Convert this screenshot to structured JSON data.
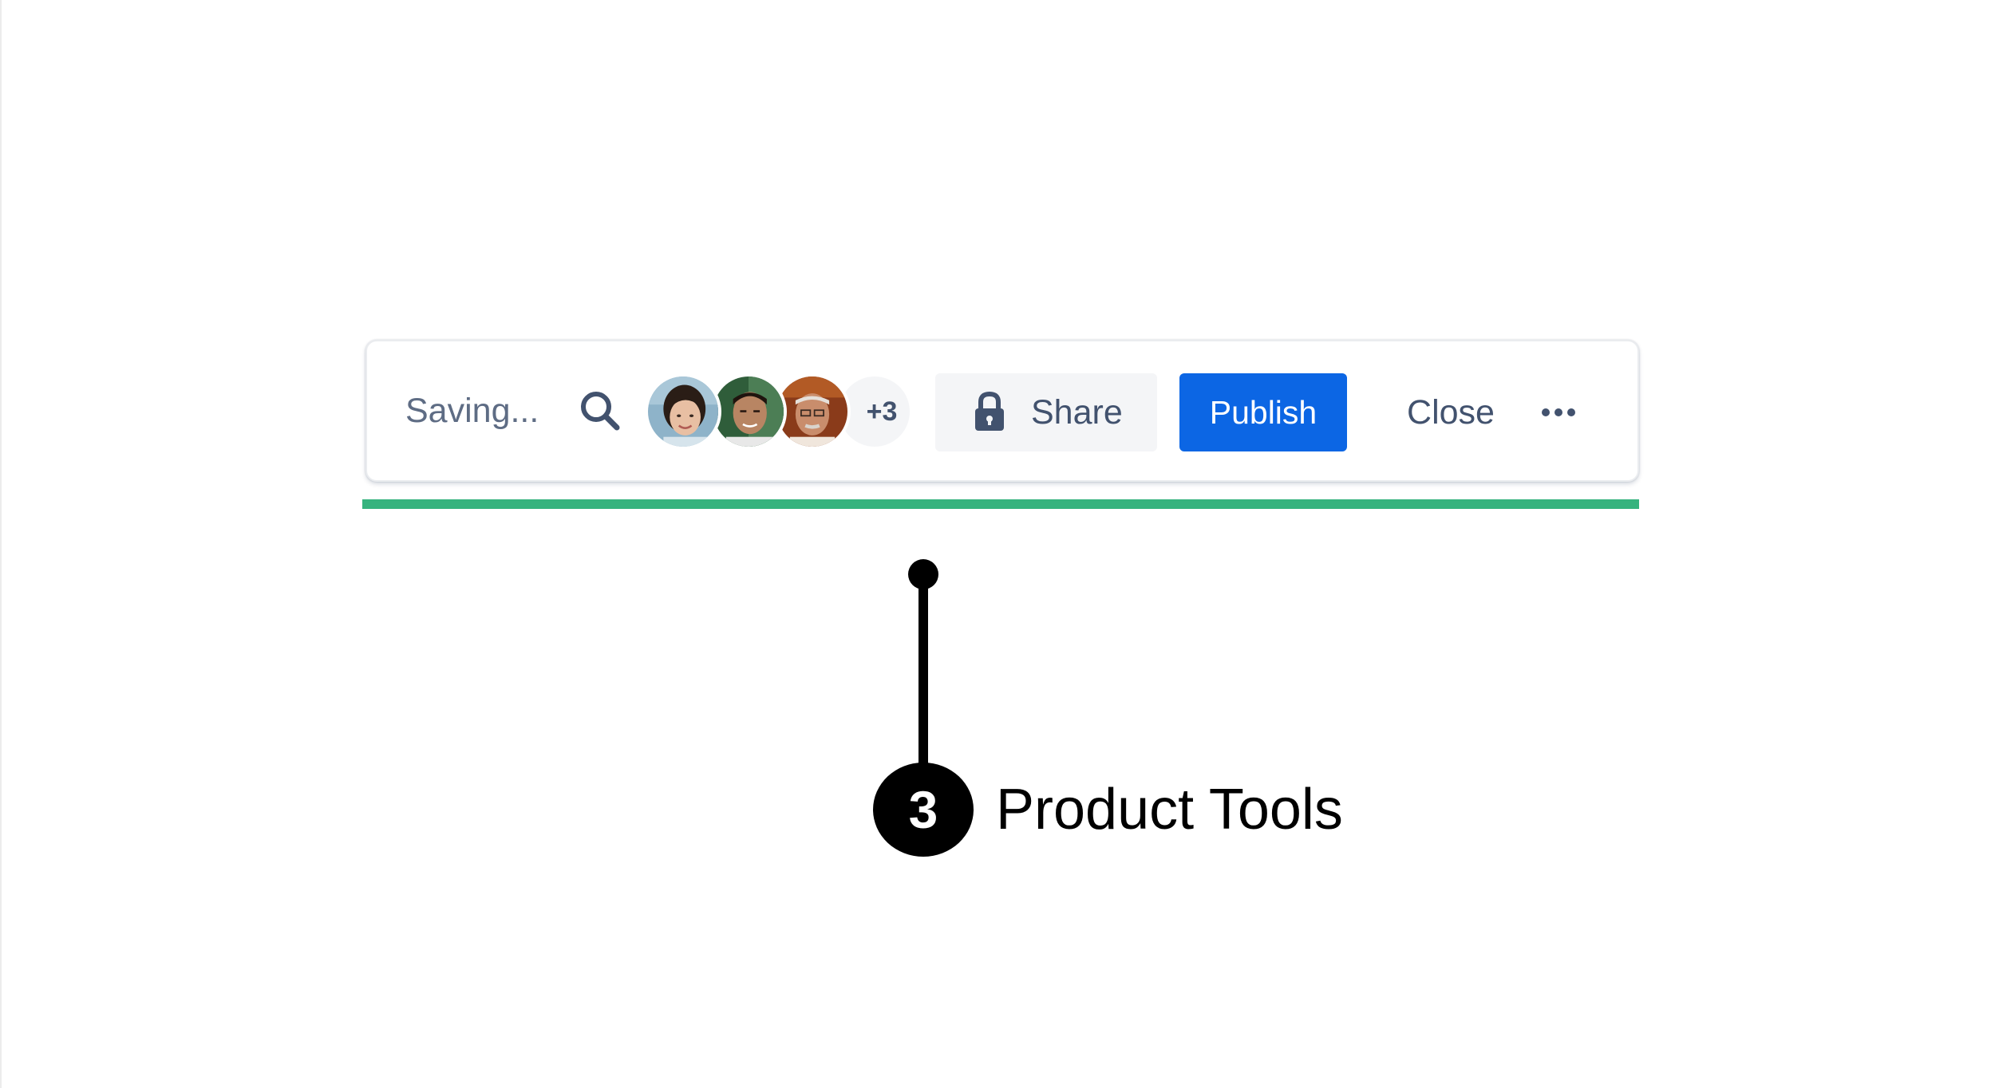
{
  "toolbar": {
    "status_text": "Saving...",
    "collaborators": {
      "overflow_count": "+3"
    },
    "share_label": "Share",
    "publish_label": "Publish",
    "close_label": "Close"
  },
  "callout": {
    "number": "3",
    "label": "Product Tools"
  },
  "colors": {
    "primary_button": "#0c66e4",
    "progress": "#36b37e",
    "text_secondary": "#5e6c84",
    "text_primary": "#42526e",
    "subtle_background": "#f4f5f7"
  },
  "icons": {
    "search": "search-icon",
    "share": "lock-icon",
    "more": "more-horizontal-icon"
  }
}
